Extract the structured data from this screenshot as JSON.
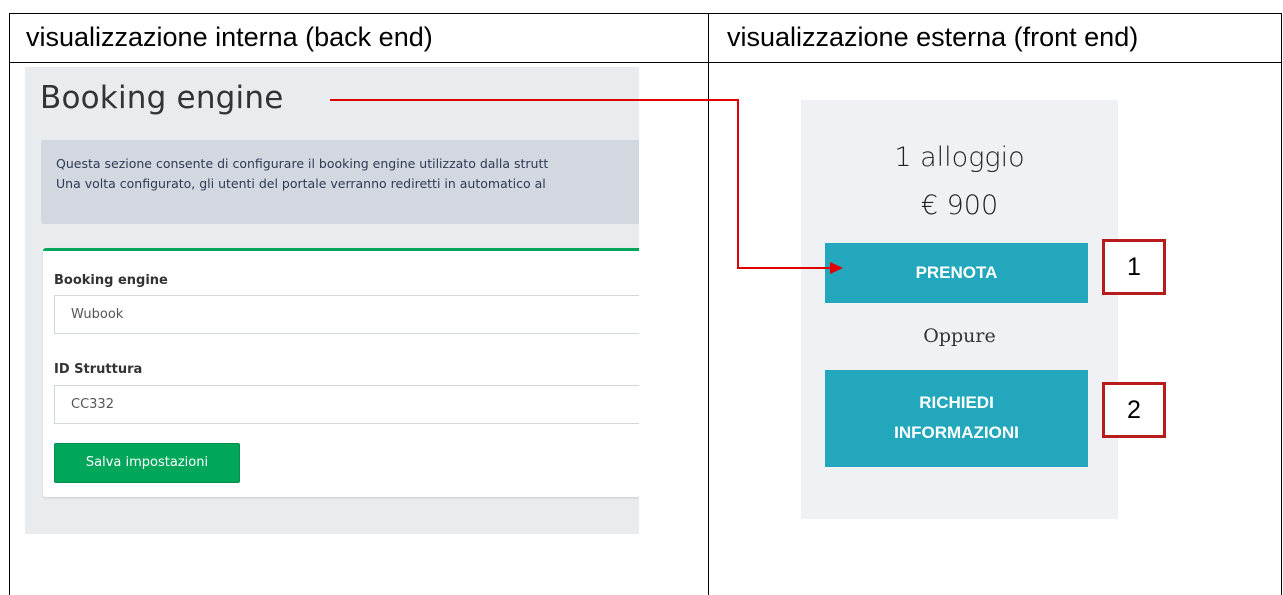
{
  "headers": {
    "left": "visualizzazione interna (back end)",
    "right": "visualizzazione esterna (front end)"
  },
  "backend": {
    "title": "Booking engine",
    "info_line1": "Questa sezione consente di configurare il booking engine utilizzato dalla strutt",
    "info_line2": "Una volta configurato, gli utenti del portale verranno rediretti in automatico al",
    "field1_label": "Booking engine",
    "field1_value": "Wubook",
    "field2_label": "ID Struttura",
    "field2_value": "CC332",
    "save_label": "Salva impostazioni"
  },
  "frontend": {
    "count": "1 alloggio",
    "price": "€ 900",
    "book_label": "PRENOTA",
    "or_label": "Oppure",
    "info_label_line1": "RICHIEDI",
    "info_label_line2": "INFORMAZIONI"
  },
  "callouts": [
    "1",
    "2"
  ],
  "colors": {
    "accent_green": "#00a65a",
    "button_teal": "#23a7bd",
    "arrow_red": "#e00000",
    "callout_border": "#b71c1c"
  }
}
